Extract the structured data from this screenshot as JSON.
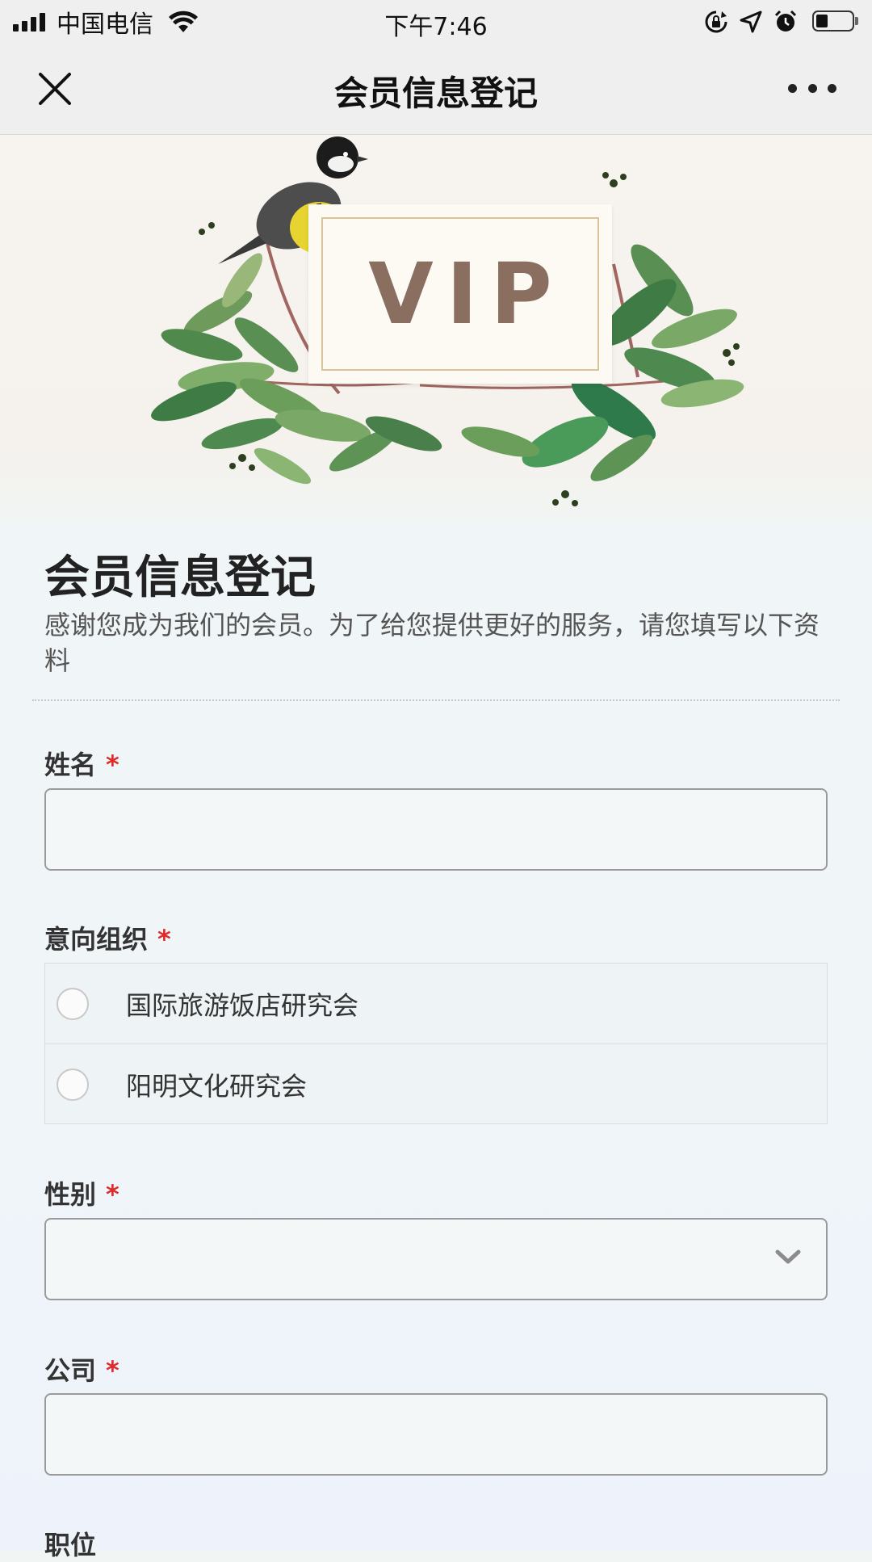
{
  "status_bar": {
    "carrier": "中国电信",
    "time": "下午7:46",
    "battery_level": 0.35
  },
  "nav": {
    "title": "会员信息登记",
    "close_icon": "close-icon",
    "more_icon": "more-icon"
  },
  "banner": {
    "vip_text": "VIP"
  },
  "form": {
    "title": "会员信息登记",
    "description": "感谢您成为我们的会员。为了给您提供更好的服务，请您填写以下资料",
    "required_mark": "*",
    "fields": {
      "name": {
        "label": "姓名",
        "value": "",
        "placeholder": ""
      },
      "organization": {
        "label": "意向组织",
        "options": [
          "国际旅游饭店研究会",
          "阳明文化研究会"
        ]
      },
      "gender": {
        "label": "性别",
        "selected": ""
      },
      "company": {
        "label": "公司",
        "value": "",
        "placeholder": ""
      },
      "position": {
        "label": "职位"
      }
    }
  },
  "colors": {
    "required": "#e02a2a",
    "vip_text": "#8a6f61",
    "vip_frame": "#d8c39a",
    "bird_yellow": "#e7d431"
  }
}
